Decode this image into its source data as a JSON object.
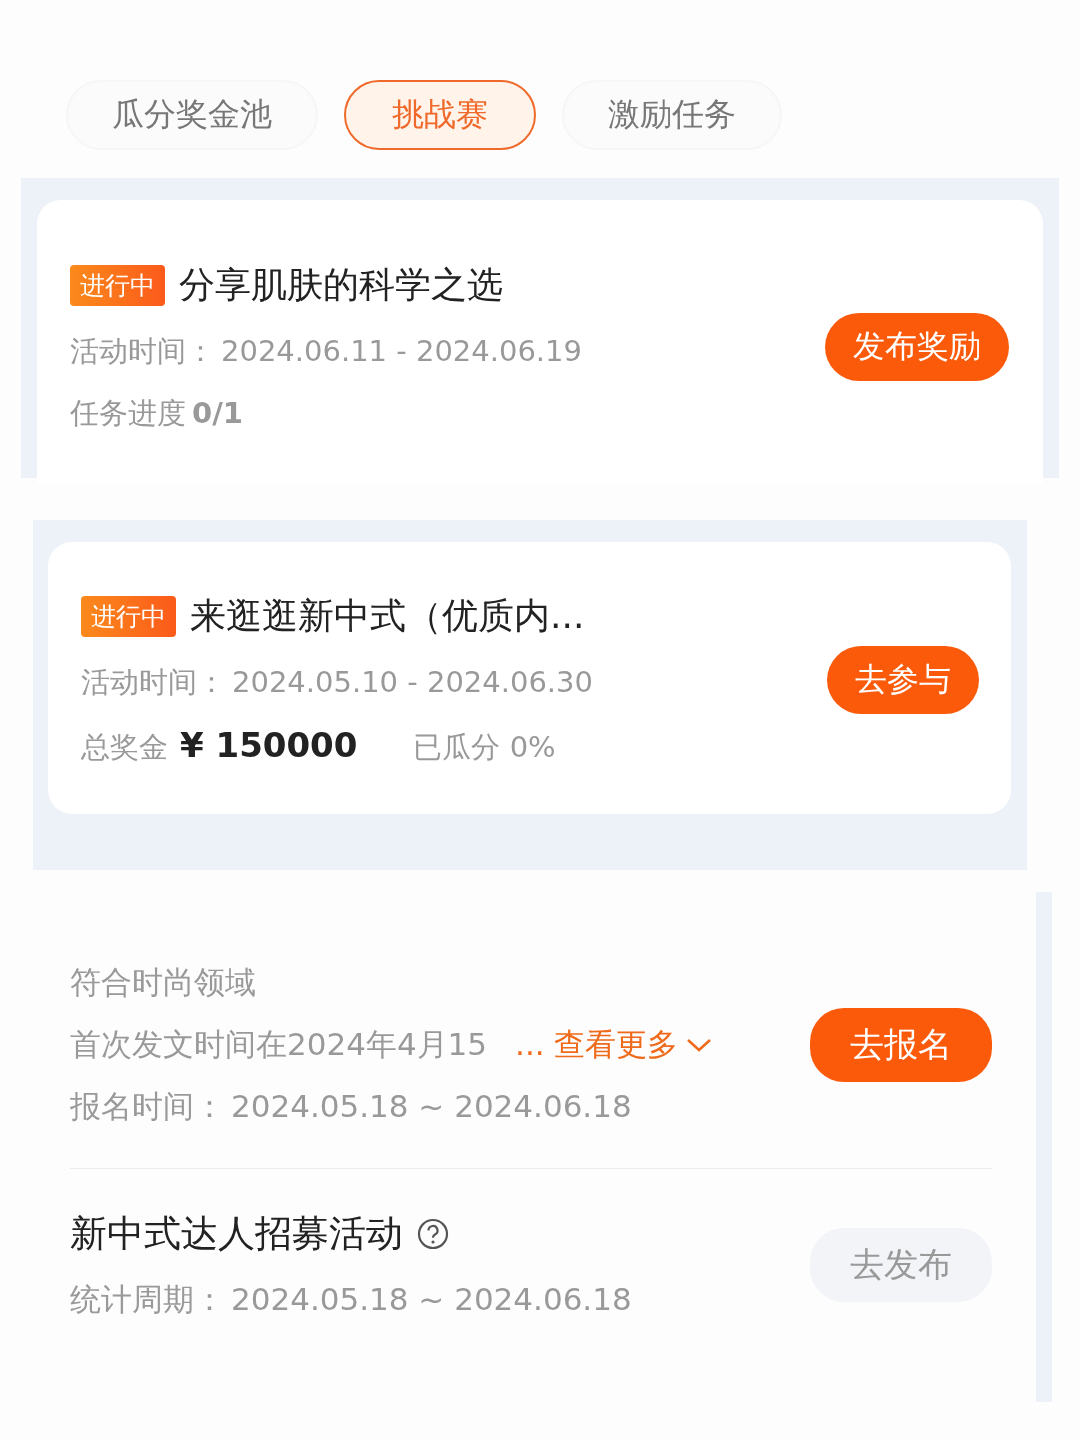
{
  "tabs": [
    {
      "label": "瓜分奖金池",
      "selected": false
    },
    {
      "label": "挑战赛",
      "selected": true
    },
    {
      "label": "激励任务",
      "selected": false
    }
  ],
  "challenges": [
    {
      "kind": "progress",
      "status": "进行中",
      "title": "分享肌肤的科学之选",
      "period_label": "活动时间：",
      "period": "2024.06.11 - 2024.06.19",
      "progress_label": "任务进度",
      "progress": "0/1",
      "button": "发布奖励"
    },
    {
      "kind": "prize",
      "status": "进行中",
      "title": "来逛逛新中式（优质内...",
      "period_label": "活动时间：",
      "period": "2024.05.10 - 2024.06.30",
      "prize_label": "总奖金",
      "prize": "¥ 150000",
      "shared": "已瓜分 0%",
      "button": "去参与"
    }
  ],
  "tasks": [
    {
      "kind": "signup",
      "requirement": "符合时尚领域",
      "detail": "首次发文时间在2024年4月15",
      "more": "... 查看更多",
      "period_label": "报名时间：",
      "period": "2024.05.18 ~ 2024.06.18",
      "button": "去报名",
      "disabled": false
    },
    {
      "kind": "publish",
      "title": "新中式达人招募活动",
      "period_label": "统计周期：",
      "period": "2024.05.18 ~ 2024.06.18",
      "button": "去发布",
      "disabled": true
    }
  ]
}
